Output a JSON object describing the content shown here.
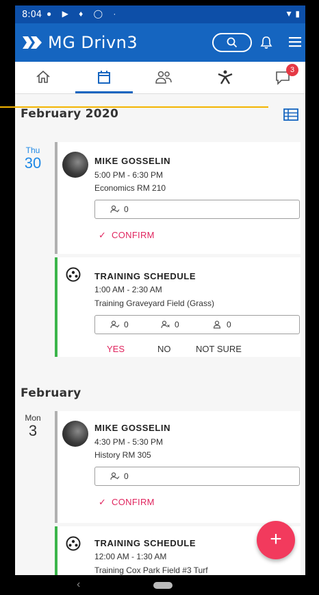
{
  "status_bar": {
    "time": "8:04"
  },
  "app": {
    "title": "MG Drivn3"
  },
  "tabs": {
    "messages_badge": "3"
  },
  "sections": [
    {
      "month": "February 2020",
      "day_weekday": "Thu",
      "day_number": "30",
      "events": [
        {
          "title": "MIKE GOSSELIN",
          "time": "5:00 PM - 6:30 PM",
          "location": "Economics RM 210",
          "accepted_count": "0",
          "confirm_label": "CONFIRM"
        },
        {
          "title": "TRAINING SCHEDULE",
          "time": "1:00 AM - 2:30 AM",
          "location": "Training Graveyard Field (Grass)",
          "accepted_count": "0",
          "declined_count": "0",
          "unsure_count": "0",
          "yes_label": "YES",
          "no_label": "NO",
          "not_sure_label": "NOT SURE"
        }
      ]
    },
    {
      "month": "February",
      "day_weekday": "Mon",
      "day_number": "3",
      "events": [
        {
          "title": "MIKE GOSSELIN",
          "time": "4:30 PM - 5:30 PM",
          "location": "History RM 305",
          "accepted_count": "0",
          "confirm_label": "CONFIRM"
        },
        {
          "title": "TRAINING SCHEDULE",
          "time": "12:00 AM - 1:30 AM",
          "location": "Training Cox Park Field #3 Turf"
        }
      ]
    }
  ],
  "fab": {
    "label": "+"
  },
  "colors": {
    "primary": "#1565c0",
    "accent": "#e0245e",
    "fab": "#f23a5d",
    "badge": "#e53945",
    "green_bar": "#3bb54a",
    "grey_bar": "#b0b0b0",
    "day_blue": "#1e88e5"
  }
}
